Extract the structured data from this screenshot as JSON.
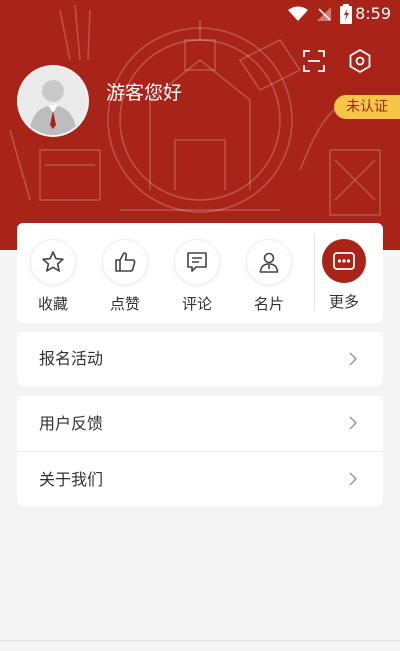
{
  "status": {
    "time": "8:59"
  },
  "profile": {
    "greeting": "游客您好",
    "verify_badge": "未认证"
  },
  "quick_actions": [
    {
      "label": "收藏",
      "icon": "star-icon"
    },
    {
      "label": "点赞",
      "icon": "thumbs-up-icon"
    },
    {
      "label": "评论",
      "icon": "comment-icon"
    },
    {
      "label": "名片",
      "icon": "user-card-icon"
    }
  ],
  "more": {
    "label": "更多",
    "icon": "more-icon"
  },
  "menu": {
    "signup": "报名活动",
    "feedback": "用户反馈",
    "about": "关于我们"
  },
  "colors": {
    "brand": "#a82418",
    "badge": "#f6c646",
    "background": "#f4f4f4"
  }
}
